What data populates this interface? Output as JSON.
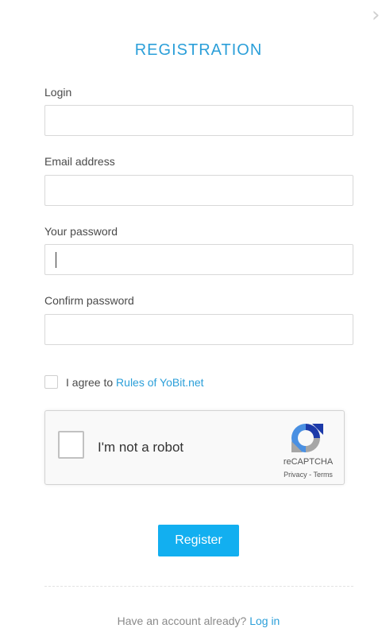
{
  "header": {
    "title": "REGISTRATION"
  },
  "form": {
    "fields": [
      {
        "label": "Login",
        "value": ""
      },
      {
        "label": "Email address",
        "value": ""
      },
      {
        "label": "Your password",
        "value": ""
      },
      {
        "label": "Confirm password",
        "value": ""
      }
    ],
    "agree": {
      "text": "I agree to",
      "link": "Rules of YoBit.net",
      "checked": false
    }
  },
  "captcha": {
    "label": "I'm not a robot",
    "brand": "reCAPTCHA",
    "privacy": "Privacy",
    "separator": "-",
    "terms": "Terms"
  },
  "actions": {
    "register_label": "Register"
  },
  "footer": {
    "text": "Have an account already?",
    "link": "Log in"
  },
  "colors": {
    "accent": "#2b9fd9",
    "button": "#12aff0"
  },
  "icons": {
    "close": "chevron-right-icon",
    "captcha": "recaptcha-logo-icon"
  }
}
